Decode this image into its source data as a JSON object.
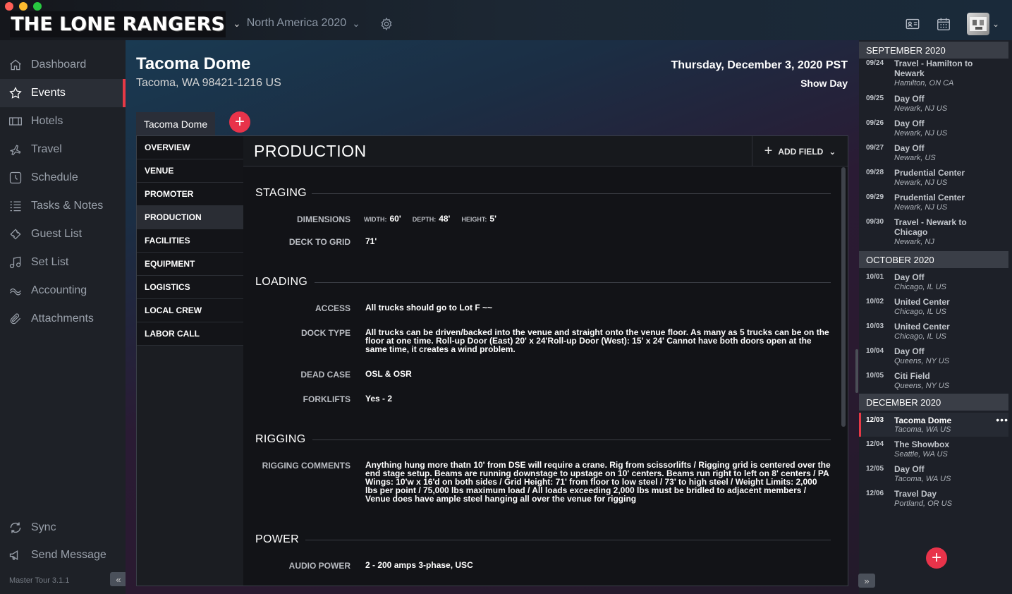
{
  "window": {
    "controls": [
      "close",
      "minimize",
      "zoom"
    ]
  },
  "topbar": {
    "logo_text": "THE LONE RANGERS",
    "tour_name": "North America 2020",
    "icons": [
      "gear-icon",
      "contact-card-icon",
      "calendar-icon",
      "avatar"
    ]
  },
  "sidebar": {
    "items": [
      {
        "label": "Dashboard",
        "icon": "home-icon"
      },
      {
        "label": "Events",
        "icon": "star-icon"
      },
      {
        "label": "Hotels",
        "icon": "hotel-icon"
      },
      {
        "label": "Travel",
        "icon": "plane-icon"
      },
      {
        "label": "Schedule",
        "icon": "clock-icon"
      },
      {
        "label": "Tasks & Notes",
        "icon": "list-icon"
      },
      {
        "label": "Guest List",
        "icon": "ticket-icon"
      },
      {
        "label": "Set List",
        "icon": "music-icon"
      },
      {
        "label": "Accounting",
        "icon": "money-icon"
      },
      {
        "label": "Attachments",
        "icon": "paperclip-icon"
      }
    ],
    "active": "Events",
    "bottom": [
      {
        "label": "Sync",
        "icon": "sync-icon"
      },
      {
        "label": "Send Message",
        "icon": "megaphone-icon"
      }
    ],
    "version": "Master Tour 3.1.1"
  },
  "header": {
    "venue": "Tacoma Dome",
    "address": "Tacoma, WA 98421-1216 US",
    "date": "Thursday, December 3, 2020 PST",
    "day_type": "Show Day"
  },
  "tabs": {
    "items": [
      "Tacoma Dome"
    ]
  },
  "sections": [
    "OVERVIEW",
    "VENUE",
    "PROMOTER",
    "PRODUCTION",
    "FACILITIES",
    "EQUIPMENT",
    "LOGISTICS",
    "LOCAL CREW",
    "LABOR CALL"
  ],
  "active_section": "PRODUCTION",
  "production": {
    "title": "PRODUCTION",
    "add_field": "ADD FIELD",
    "staging": {
      "title": "STAGING",
      "dimensions_label": "DIMENSIONS",
      "width_label": "WIDTH:",
      "width": "60'",
      "depth_label": "DEPTH:",
      "depth": "48'",
      "height_label": "HEIGHT:",
      "height": "5'",
      "deck_label": "DECK TO GRID",
      "deck": "71'"
    },
    "loading": {
      "title": "LOADING",
      "access_label": "ACCESS",
      "access": "All trucks should go to Lot F ~~",
      "dock_label": "DOCK TYPE",
      "dock": "All trucks can be driven/backed into the venue and straight onto the venue floor. As many as 5 trucks can be on the floor at one time. Roll-up Door (East) 20' x 24'Roll-up Door (West): 15' x 24' Cannot have both doors open at the same time, it creates a wind problem.",
      "deadcase_label": "DEAD CASE",
      "deadcase": "OSL & OSR",
      "forklifts_label": "FORKLIFTS",
      "forklifts": "Yes - 2"
    },
    "rigging": {
      "title": "RIGGING",
      "comments_label": "RIGGING COMMENTS",
      "comments": "Anything hung more thatn 10' from DSE will require a crane. Rig from scissorlifts / Rigging grid is centered over the end stage setup. Beams are running downstage to upstage on 10' centers. Beams run right to left on 8' centers / PA Wings: 10'w x 16'd on both sides / Grid Height: 71' from floor to low steel / 73' to high steel / Weight Limits: 2,000 lbs per point / 75,000 lbs maximum load / All loads exceeding 2,000 lbs must be bridled to adjacent members / Venue does have ample steel hanging all over the venue for rigging"
    },
    "power": {
      "title": "POWER",
      "audio_label": "AUDIO POWER",
      "audio": "2 - 200 amps 3-phase, USC"
    }
  },
  "schedule": {
    "months": [
      {
        "name": "SEPTEMBER 2020",
        "entries": [
          {
            "date": "09/24",
            "title": "Travel - Hamilton to Newark",
            "location": "Hamilton, ON CA"
          },
          {
            "date": "09/25",
            "title": "Day Off",
            "location": "Newark, NJ US"
          },
          {
            "date": "09/26",
            "title": "Day Off",
            "location": "Newark, NJ US"
          },
          {
            "date": "09/27",
            "title": "Day Off",
            "location": "Newark, US"
          },
          {
            "date": "09/28",
            "title": "Prudential Center",
            "location": "Newark, NJ US"
          },
          {
            "date": "09/29",
            "title": "Prudential Center",
            "location": "Newark, NJ US"
          },
          {
            "date": "09/30",
            "title": "Travel - Newark to Chicago",
            "location": "Newark, NJ"
          }
        ]
      },
      {
        "name": "OCTOBER 2020",
        "entries": [
          {
            "date": "10/01",
            "title": "Day Off",
            "location": "Chicago, IL US"
          },
          {
            "date": "10/02",
            "title": "United Center",
            "location": "Chicago, IL US"
          },
          {
            "date": "10/03",
            "title": "United Center",
            "location": "Chicago, IL US"
          },
          {
            "date": "10/04",
            "title": "Day Off",
            "location": "Queens, NY US"
          },
          {
            "date": "10/05",
            "title": "Citi Field",
            "location": "Queens, NY US"
          }
        ]
      },
      {
        "name": "DECEMBER 2020",
        "entries": [
          {
            "date": "12/03",
            "title": "Tacoma Dome",
            "location": "Tacoma, WA US",
            "more": "•••"
          },
          {
            "date": "12/04",
            "title": "The Showbox",
            "location": "Seattle, WA US"
          },
          {
            "date": "12/05",
            "title": "Day Off",
            "location": "Tacoma, WA US"
          },
          {
            "date": "12/06",
            "title": "Travel Day",
            "location": "Portland, OR US"
          }
        ]
      }
    ]
  },
  "colors": {
    "accent": "#e8334a",
    "active_border": "#e63946"
  }
}
